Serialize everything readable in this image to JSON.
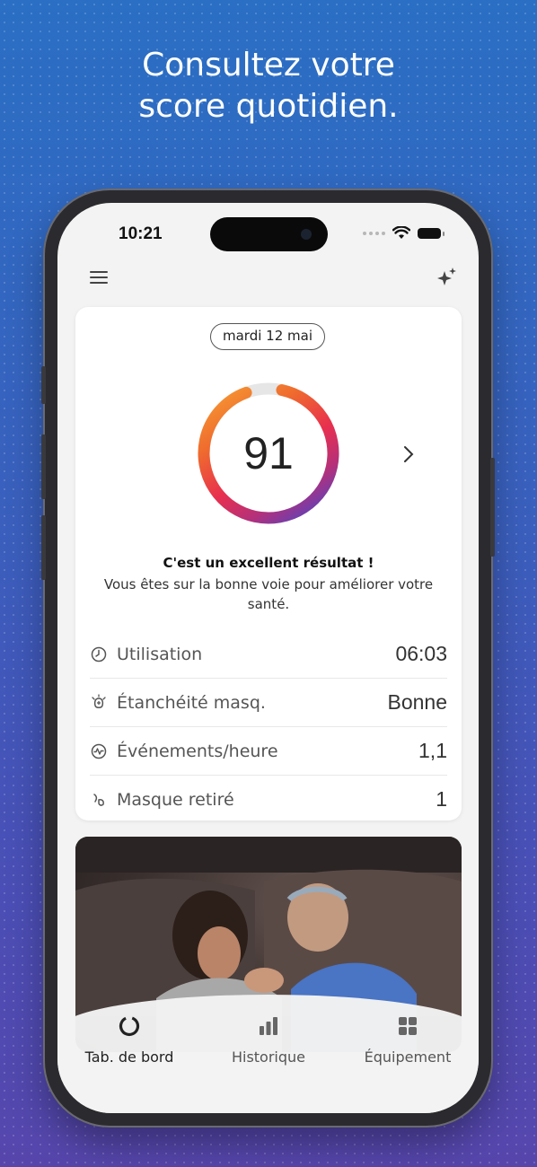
{
  "headline": {
    "line1": "Consultez votre",
    "line2": "score quotidien."
  },
  "status_bar": {
    "time": "10:21"
  },
  "header": {
    "menu_icon": "hamburger-menu-icon",
    "assistant_icon": "sparkle-icon"
  },
  "score_card": {
    "date": "mardi 12 mai",
    "score": "91",
    "score_fraction": 0.91,
    "message_title": "C'est un excellent résultat !",
    "message_body": "Vous êtes sur la bonne voie pour améliorer votre santé.",
    "metrics": [
      {
        "label": "Utilisation",
        "value": "06:03",
        "icon": "clock-icon"
      },
      {
        "label": "Étanchéité masq.",
        "value": "Bonne",
        "icon": "mask-seal-icon"
      },
      {
        "label": "Événements/heure",
        "value": "1,1",
        "icon": "pulse-icon"
      },
      {
        "label": "Masque retiré",
        "value": "1",
        "icon": "mask-removed-icon"
      }
    ]
  },
  "tabs": [
    {
      "label": "Tab. de bord",
      "icon": "dashboard-ring-icon",
      "active": true
    },
    {
      "label": "Historique",
      "icon": "bar-chart-icon",
      "active": false
    },
    {
      "label": "Équipement",
      "icon": "grid-icon",
      "active": false
    }
  ],
  "colors": {
    "ring_gradient": [
      "#f7a234",
      "#ef6a2e",
      "#e8304e",
      "#b4307a",
      "#6a3fb0",
      "#5566cc"
    ],
    "ring_track": "#e6e6e6"
  }
}
